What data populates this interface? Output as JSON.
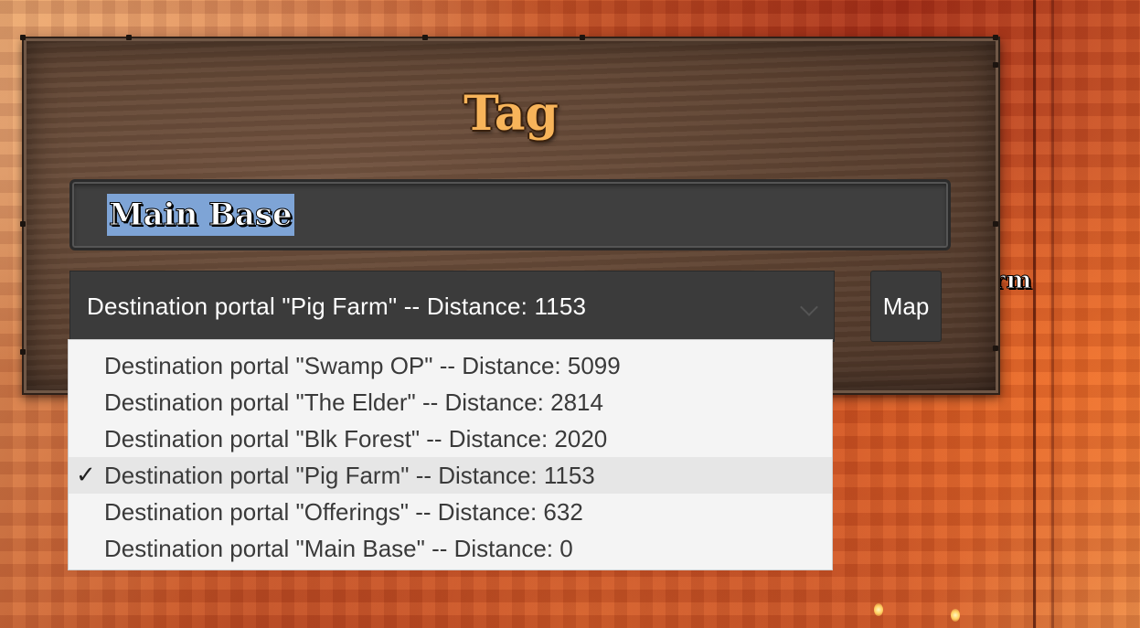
{
  "dialog": {
    "title": "Tag",
    "tag_value": "Main Base",
    "map_button_label": "Map"
  },
  "background": {
    "partial_label": "rm"
  },
  "destination": {
    "selected_label": "Destination portal \"Pig Farm\"  --  Distance: 1153",
    "options": [
      {
        "label": "Destination portal \"Swamp OP\"  --  Distance: 5099",
        "selected": false
      },
      {
        "label": "Destination portal \"The Elder\"  --  Distance: 2814",
        "selected": false
      },
      {
        "label": "Destination portal \"Blk Forest\"  --  Distance: 2020",
        "selected": false
      },
      {
        "label": "Destination portal \"Pig Farm\"  --  Distance: 1153",
        "selected": true
      },
      {
        "label": "Destination portal \"Offerings\"  --  Distance: 632",
        "selected": false
      },
      {
        "label": "Destination portal \"Main Base\"  --  Distance: 0",
        "selected": false
      }
    ],
    "check_glyph": "✓"
  }
}
